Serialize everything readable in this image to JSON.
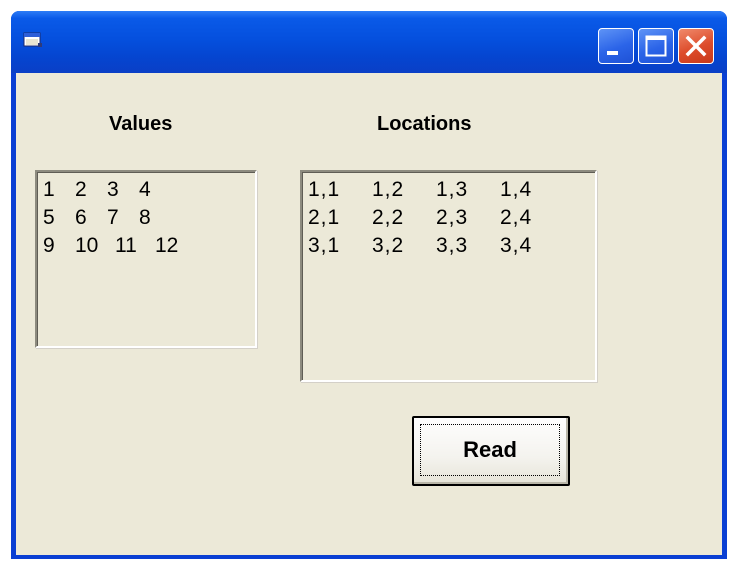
{
  "window": {
    "title": "",
    "app_icon": "form-app-icon",
    "controls": {
      "minimize_icon": "minimize-icon",
      "maximize_icon": "maximize-icon",
      "close_icon": "close-icon"
    },
    "colors": {
      "titlebar": "#0550de",
      "client_background": "#ece9d8",
      "close_button": "#dd4c2b"
    }
  },
  "values_list": {
    "label": "Values",
    "rows": [
      [
        "1",
        "2",
        "3",
        "4"
      ],
      [
        "5",
        "6",
        "7",
        "8"
      ],
      [
        "9",
        "10",
        "11",
        "12"
      ]
    ]
  },
  "locations_list": {
    "label": "Locations",
    "rows": [
      [
        "1,1",
        "1,2",
        "1,3",
        "1,4"
      ],
      [
        "2,1",
        "2,2",
        "2,3",
        "2,4"
      ],
      [
        "3,1",
        "3,2",
        "3,3",
        "3,4"
      ]
    ]
  },
  "read_button": {
    "label": "Read"
  }
}
